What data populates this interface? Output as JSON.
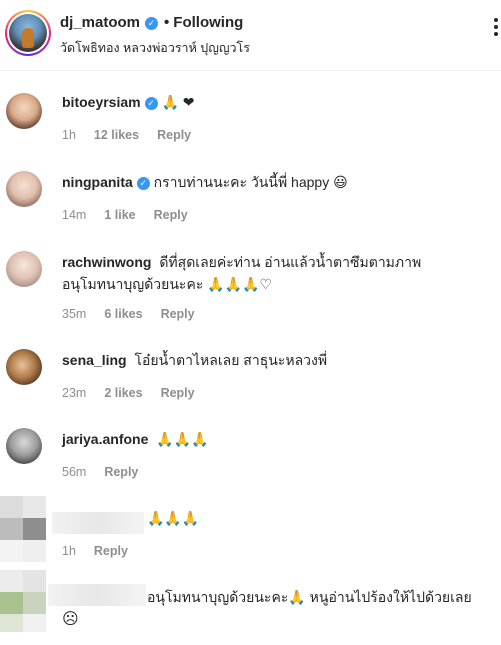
{
  "header": {
    "username": "dj_matoom",
    "verified_mark": "✓",
    "separator": "•",
    "follow_label": "Following",
    "location": "วัดโพธิทอง หลวงพ่อวราห์ ปุญญวโร"
  },
  "icons": {
    "verified": "verified-badge-icon",
    "more": "more-options-icon",
    "pray": "🙏",
    "heart": "❤",
    "heart_outline": "♡",
    "smile": "😃",
    "sad": "☹"
  },
  "colors": {
    "verified_blue": "#3897f0",
    "heart_red": "#ed4956",
    "meta_gray": "#8e8e8e",
    "text": "#262626"
  },
  "comments": [
    {
      "username": "bitoeyrsiam",
      "text": "🙏 ❤",
      "time": "1h",
      "likes": "12 likes",
      "reply": "Reply"
    },
    {
      "username": "ningpanita",
      "text": "กราบท่านนะคะ วันนี้พี่ happy 😃",
      "time": "14m",
      "likes": "1 like",
      "reply": "Reply"
    },
    {
      "username": "rachwinwong",
      "text": "ดีที่สุดเลยค่ะท่าน อ่านแล้วน้ำตาซึมตามภาพ",
      "text2": "อนุโมทนาบุญด้วยนะคะ 🙏🙏🙏♡",
      "time": "35m",
      "likes": "6 likes",
      "reply": "Reply"
    },
    {
      "username": "sena_ling",
      "text": "โอ๋ยน้ำตาไหลเลย สาธุนะหลวงพี่",
      "time": "23m",
      "likes": "2 likes",
      "reply": "Reply"
    },
    {
      "username": "jariya.anfone",
      "text": "🙏🙏🙏",
      "time": "56m",
      "reply": "Reply"
    },
    {
      "text": "🙏🙏🙏",
      "time": "1h",
      "reply": "Reply"
    },
    {
      "text": "อนุโมทนาบุญด้วยนะคะ🙏 หนูอ่านไปร้องให้ไปด้วยเลย",
      "text2": "☹"
    }
  ]
}
